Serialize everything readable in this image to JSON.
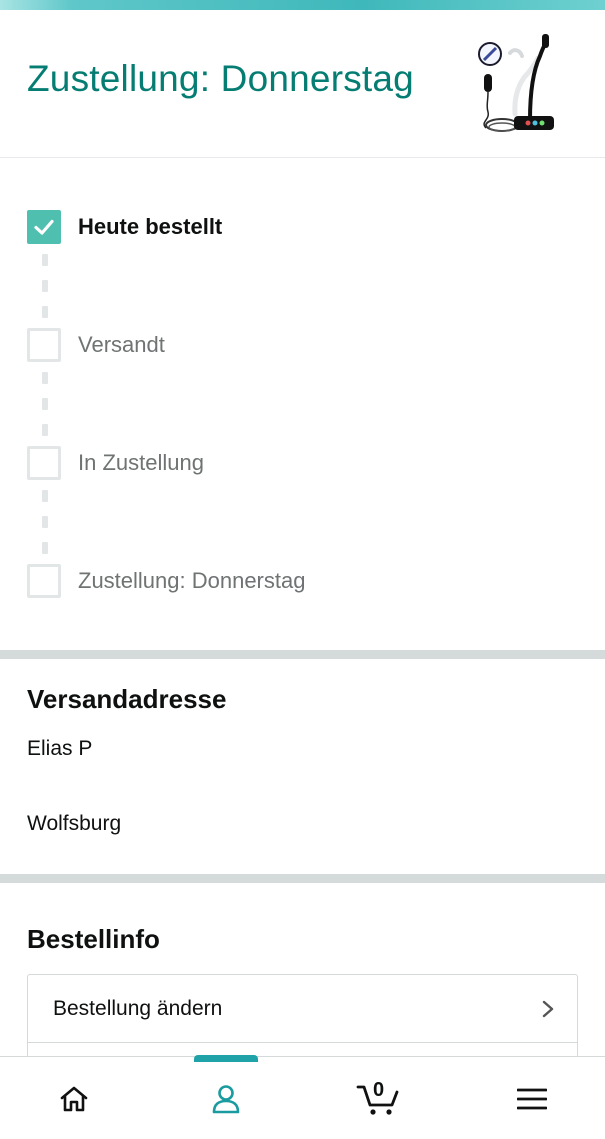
{
  "header": {
    "title": "Zustellung: Donnerstag",
    "product_image": "microphone-product-image"
  },
  "tracker": {
    "steps": [
      {
        "label": "Heute bestellt",
        "completed": true
      },
      {
        "label": "Versandt",
        "completed": false
      },
      {
        "label": "In Zustellung",
        "completed": false
      },
      {
        "label": "Zustellung: Donnerstag",
        "completed": false
      }
    ]
  },
  "shipping": {
    "title": "Versandadresse",
    "name": "Elias P",
    "city": "Wolfsburg"
  },
  "order_info": {
    "title": "Bestellinfo",
    "rows": [
      {
        "label": "Bestellung ändern"
      }
    ]
  },
  "bottom_nav": {
    "items": [
      {
        "icon": "home-icon",
        "active": false
      },
      {
        "icon": "account-icon",
        "active": true
      },
      {
        "icon": "cart-icon",
        "active": false
      },
      {
        "icon": "menu-icon",
        "active": false
      }
    ],
    "cart_count": "0"
  },
  "colors": {
    "accent": "#067d73",
    "check": "#4fbfb0",
    "nav_active": "#1fa3a8"
  }
}
